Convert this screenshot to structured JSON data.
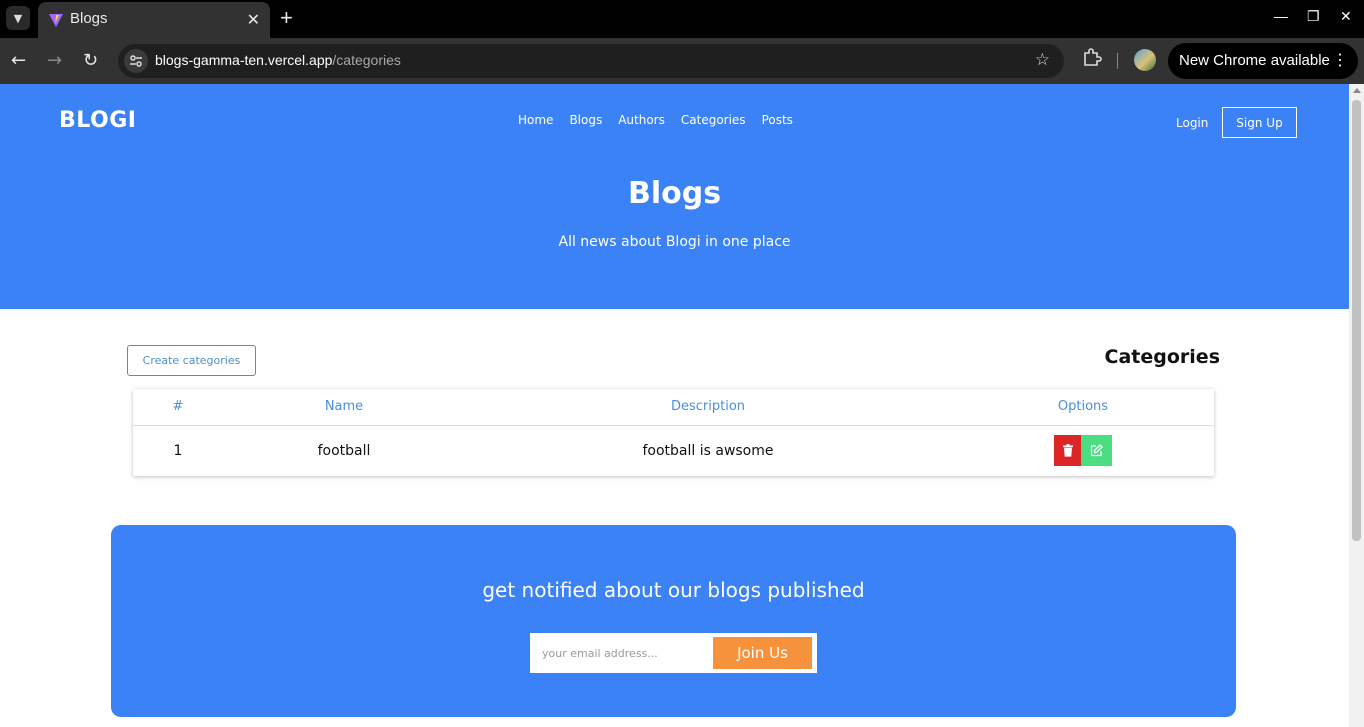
{
  "browser": {
    "tab_title": "Blogs",
    "url_host": "blogs-gamma-ten.vercel.app",
    "url_path": "/categories",
    "update_label": "New Chrome available"
  },
  "site": {
    "brand": "BLOGI",
    "nav": [
      "Home",
      "Blogs",
      "Authors",
      "Categories",
      "Posts"
    ],
    "login": "Login",
    "signup": "Sign Up",
    "hero_title": "Blogs",
    "hero_subtitle": "All news about Blogi in one place"
  },
  "categories": {
    "create_button": "Create categories",
    "title": "Categories",
    "columns": [
      "#",
      "Name",
      "Description",
      "Options"
    ],
    "rows": [
      {
        "id": "1",
        "name": "football",
        "description": "football is awsome"
      }
    ]
  },
  "subscribe": {
    "title": "get notified about our blogs published",
    "placeholder": "your email address...",
    "button": "Join Us"
  },
  "colors": {
    "primary": "#3b82f6",
    "delete": "#dc2626",
    "edit": "#4ade80",
    "join": "#f6923b"
  }
}
